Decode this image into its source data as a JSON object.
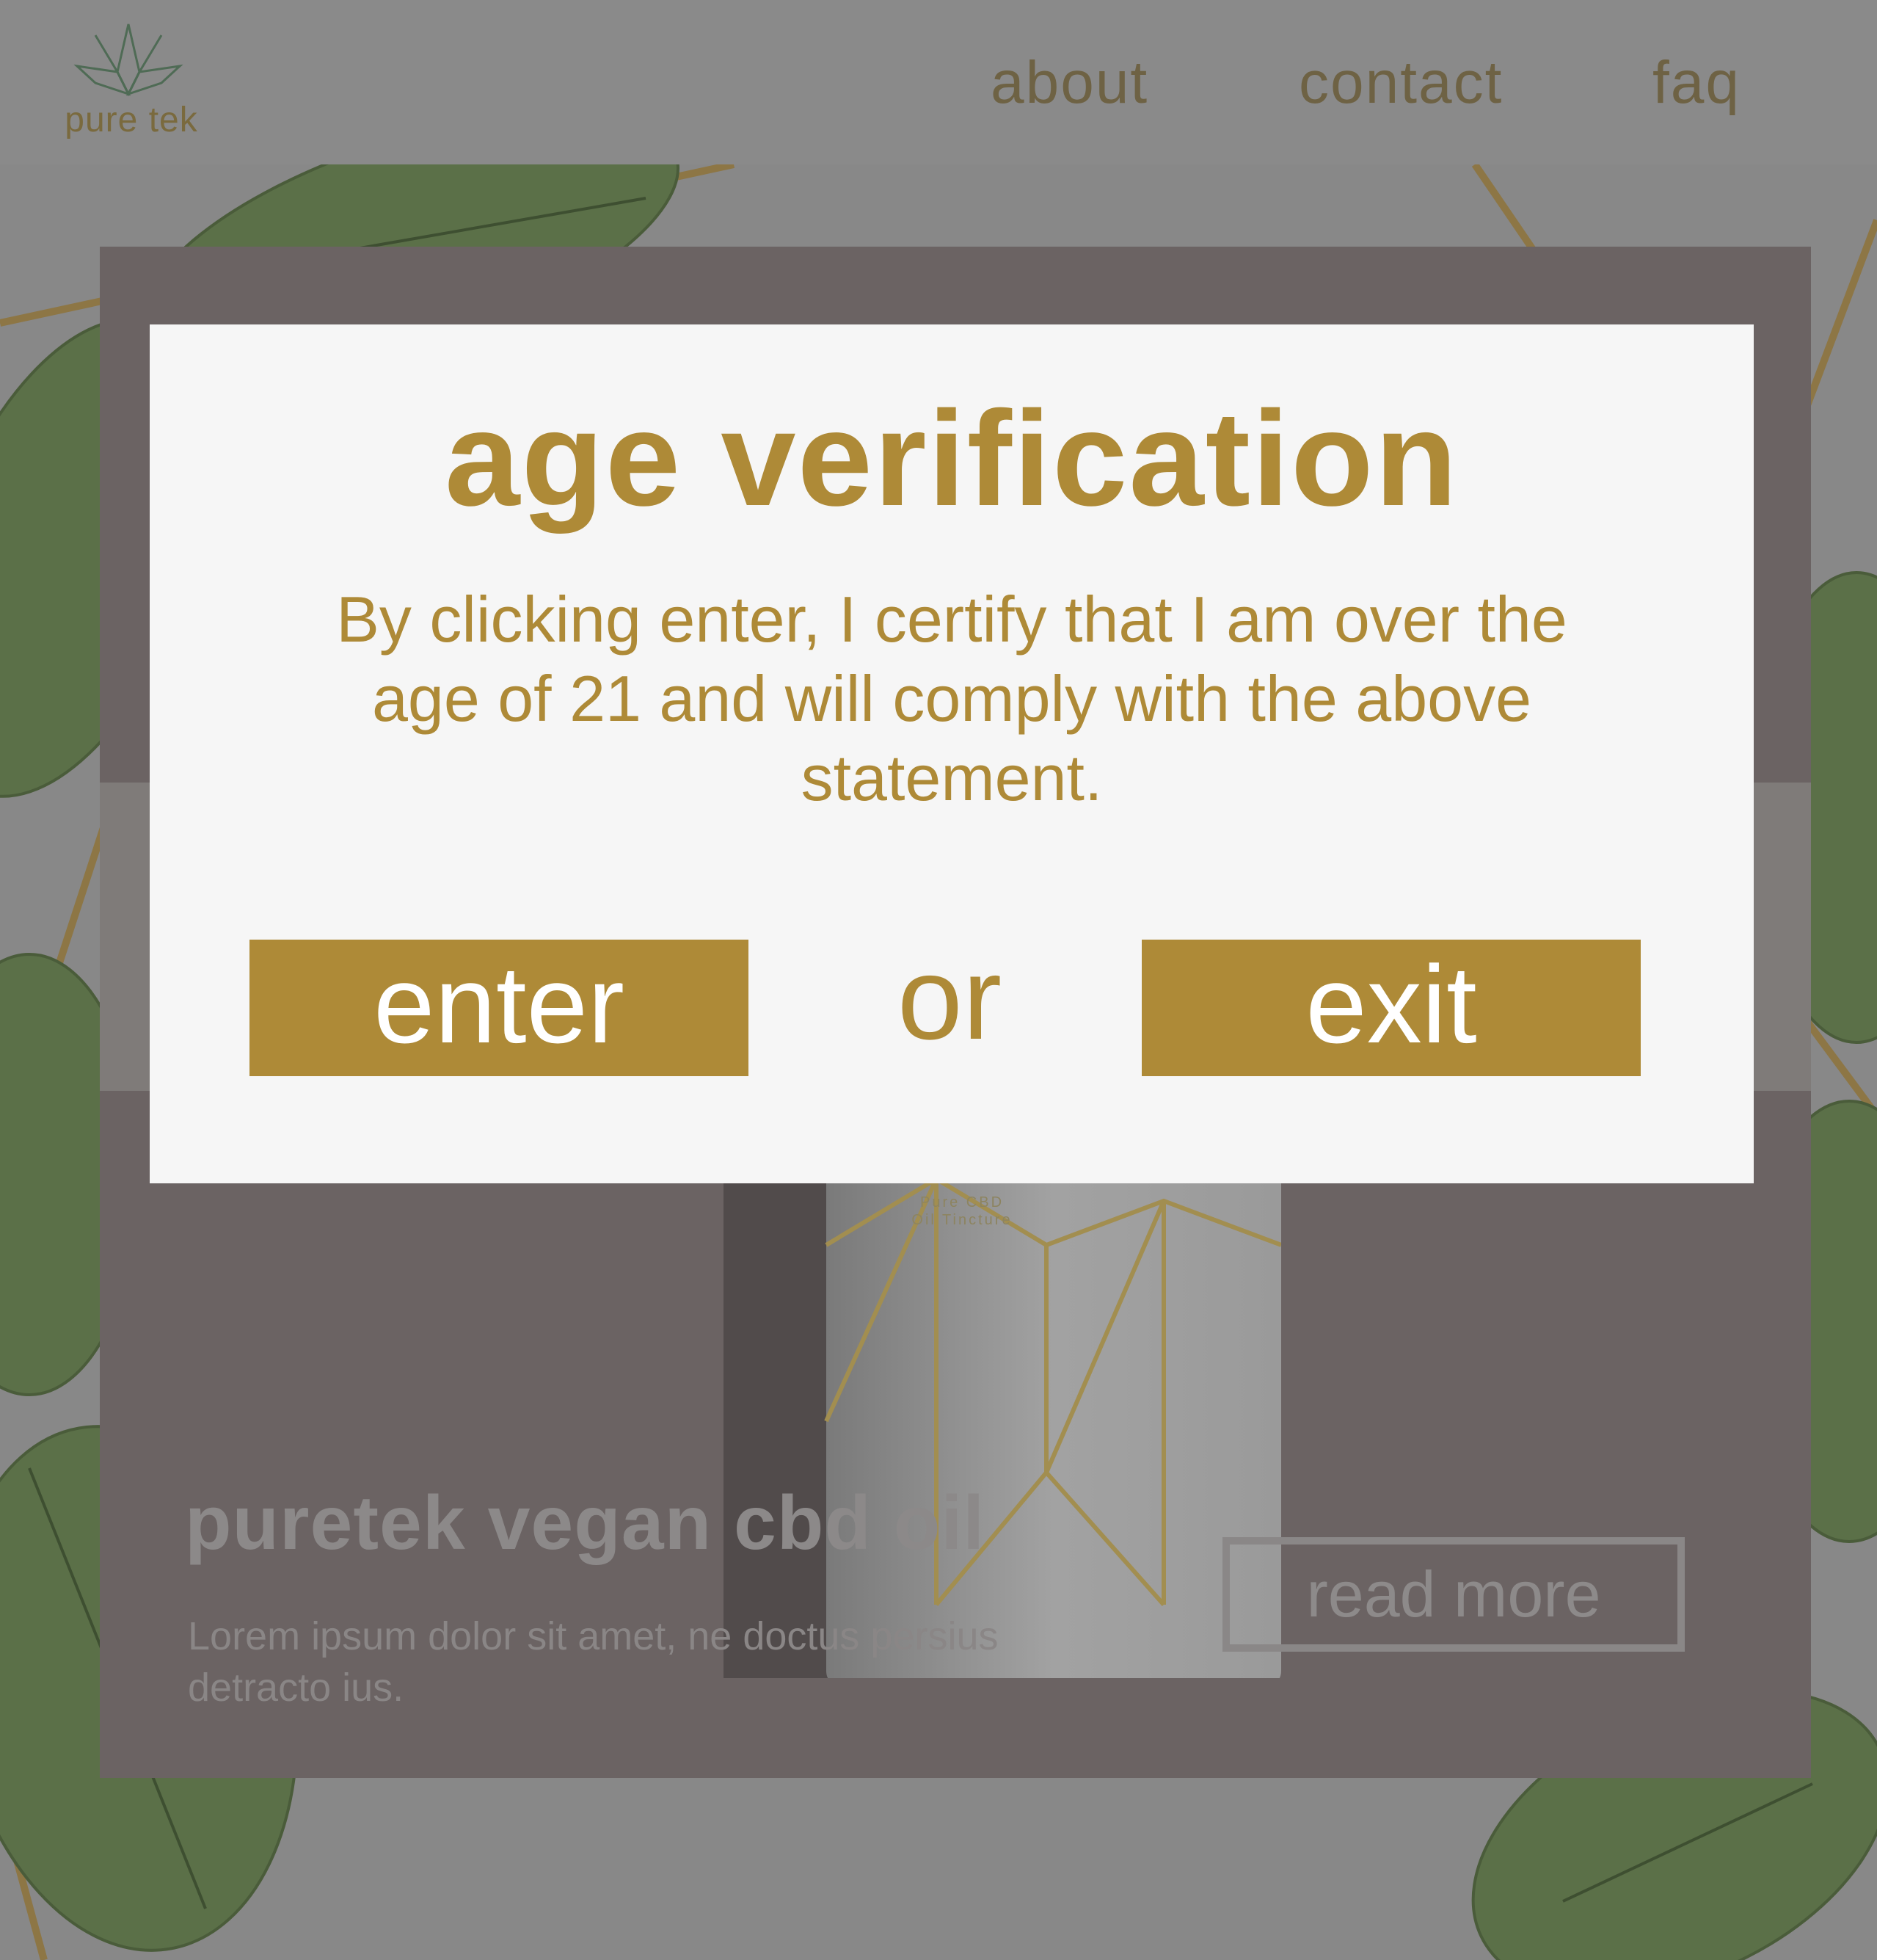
{
  "brand": {
    "name": "pure tek"
  },
  "nav": {
    "items": [
      {
        "label": "about"
      },
      {
        "label": "contact"
      },
      {
        "label": "faq"
      }
    ]
  },
  "product": {
    "title": "puretek vegan cbd oil",
    "description": "Lorem ipsum dolor sit amet, ne doctus persius detracto ius.",
    "read_more_label": "read more",
    "bottle_label_line1": "Pure CBD",
    "bottle_label_line2": "Oil Tincture"
  },
  "modal": {
    "title": "age verification",
    "body": "By clicking enter, I certify that I am over the age of 21 and will comply with the above statement.",
    "enter_label": "enter",
    "or_label": "or",
    "exit_label": "exit"
  },
  "colors": {
    "accent_gold": "#ae8a37",
    "overlay_gray": "#888888",
    "card_bg": "#6b6363",
    "modal_bg": "#f6f6f6",
    "leaf_green": "#5b7048"
  }
}
